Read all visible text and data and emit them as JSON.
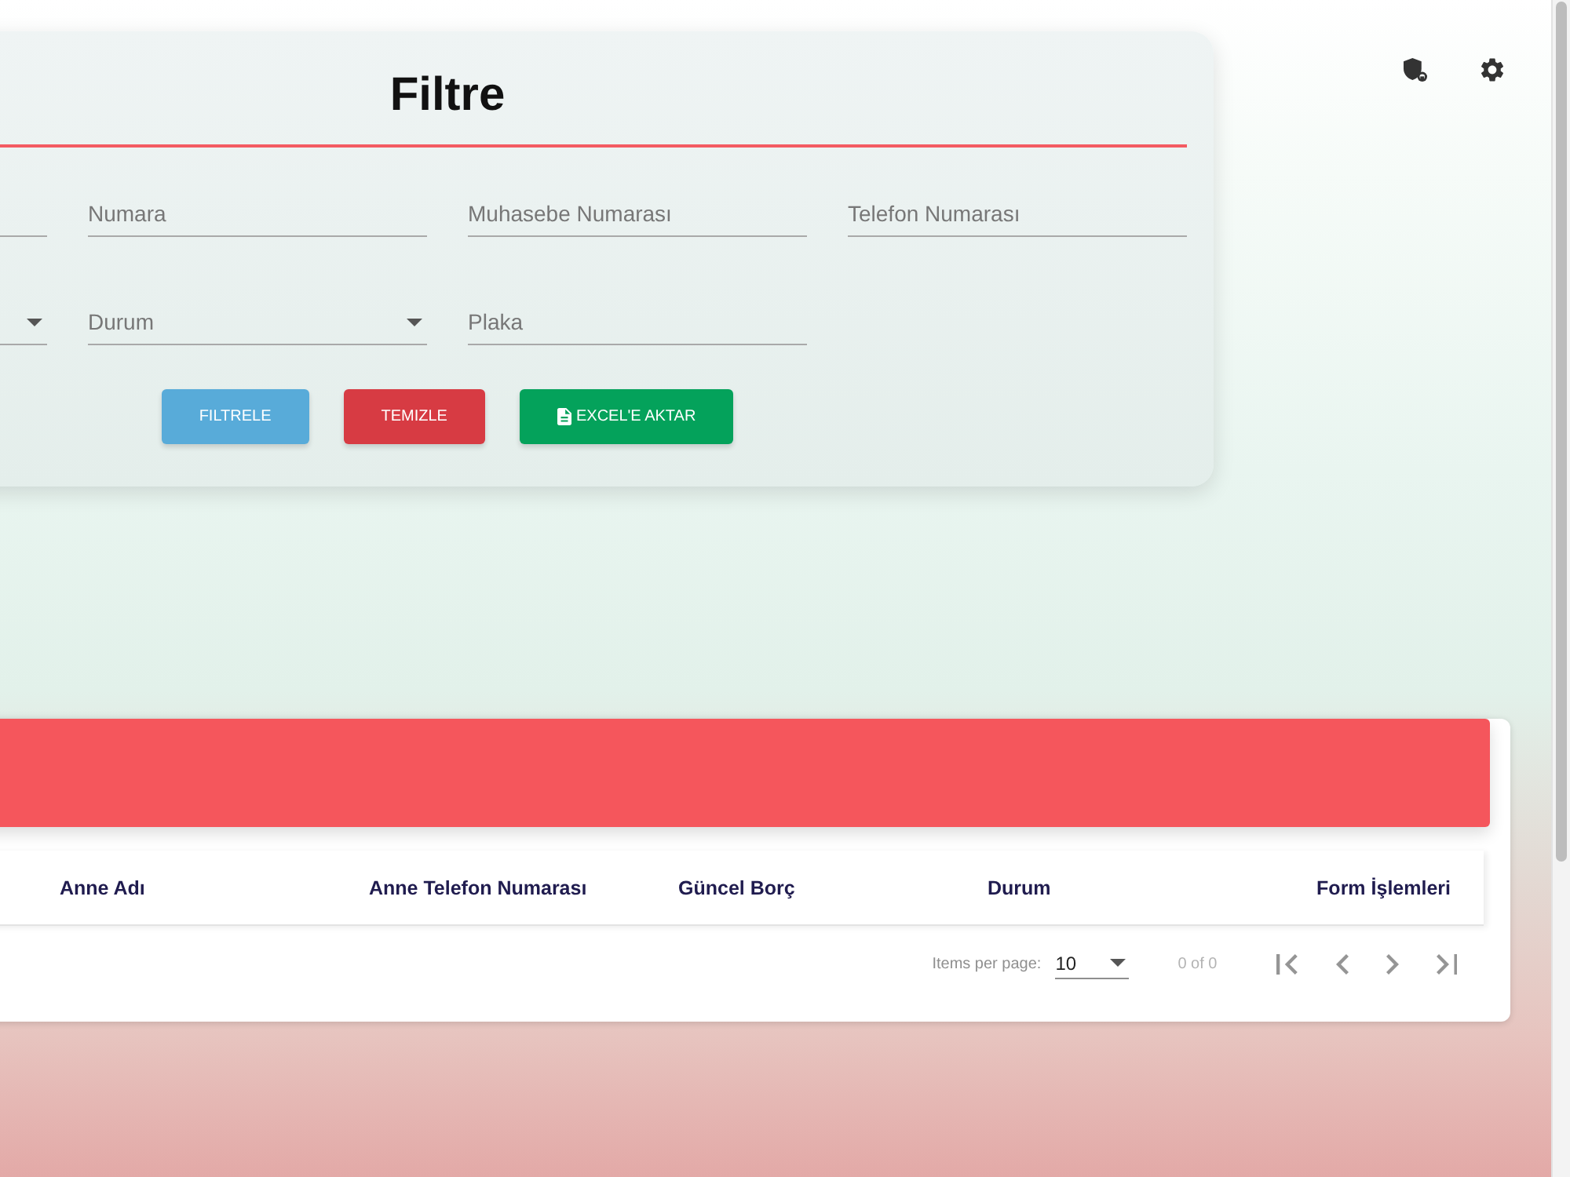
{
  "filter_panel": {
    "title": "Filtre",
    "rows": [
      [
        {
          "kind": "text"
        },
        {
          "kind": "text",
          "placeholder": "Numara"
        },
        {
          "kind": "text",
          "placeholder": "Muhasebe Numarası"
        },
        {
          "kind": "text",
          "placeholder": "Telefon Numarası"
        }
      ],
      [
        {
          "kind": "select"
        },
        {
          "kind": "select",
          "placeholder": "Durum"
        },
        {
          "kind": "text",
          "placeholder": "Plaka"
        }
      ]
    ],
    "buttons": [
      {
        "kind": "filter",
        "label": "FILTRELE"
      },
      {
        "kind": "clear",
        "label": "TEMIZLE"
      },
      {
        "kind": "export",
        "label": "EXCEL'E AKTAR"
      }
    ]
  },
  "table": {
    "columns": [
      "Anne Adı",
      "Anne Telefon Numarası",
      "Güncel Borç",
      "Durum",
      "Form İşlemleri"
    ]
  },
  "paginator": {
    "items_per_page_label": "Items per page:",
    "page_size": "10",
    "range_label": "0 of 0"
  }
}
